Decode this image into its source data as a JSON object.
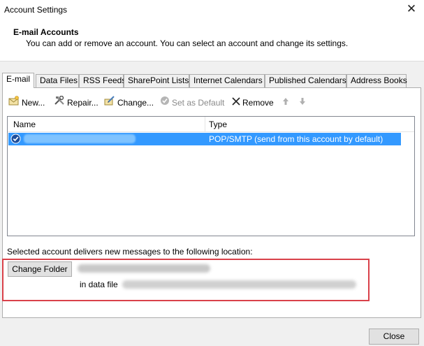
{
  "window": {
    "title": "Account Settings",
    "close_glyph": "✕"
  },
  "header": {
    "title": "E-mail Accounts",
    "description": "You can add or remove an account. You can select an account and change its settings."
  },
  "tabs": [
    {
      "label": "E-mail",
      "active": true
    },
    {
      "label": "Data Files"
    },
    {
      "label": "RSS Feeds"
    },
    {
      "label": "SharePoint Lists"
    },
    {
      "label": "Internet Calendars"
    },
    {
      "label": "Published Calendars"
    },
    {
      "label": "Address Books"
    }
  ],
  "toolbar": {
    "new_label": "New...",
    "repair_label": "Repair...",
    "change_label": "Change...",
    "set_default_label": "Set as Default",
    "remove_label": "Remove"
  },
  "accounts_list": {
    "columns": {
      "name": "Name",
      "type": "Type"
    },
    "rows": [
      {
        "name": "",
        "type": "POP/SMTP (send from this account by default)",
        "selected": true
      }
    ]
  },
  "delivery": {
    "label": "Selected account delivers new messages to the following location:",
    "change_folder_label": "Change Folder",
    "folder_value": "",
    "data_file_label": "in data file",
    "data_file_value": ""
  },
  "footer": {
    "close_label": "Close"
  },
  "colors": {
    "selection": "#3399ff",
    "highlight_box": "#d9414a",
    "dialog_bg": "#f0f0f0"
  }
}
